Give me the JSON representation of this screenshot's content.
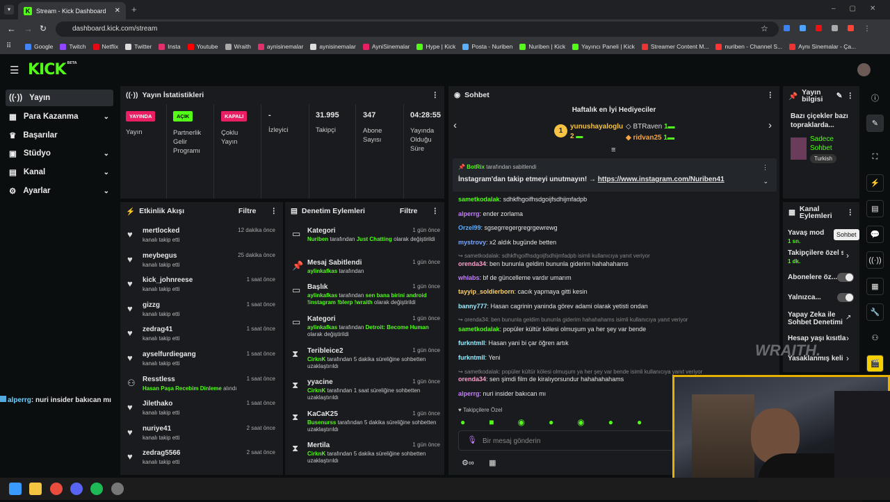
{
  "browser": {
    "tab_title": "Stream - Kick Dashboard",
    "url": "dashboard.kick.com/stream",
    "bookmarks": [
      "Google",
      "Twitch",
      "Netflix",
      "Twitter",
      "Insta",
      "Youtube",
      "Wraith",
      "aynisinemalar",
      "aynisinemalar",
      "AyniSinemalar",
      "Hype | Kick",
      "Posta - Nuriben",
      "Nuriben | Kick",
      "Yayıncı Paneli | Kick",
      "Streamer Content M...",
      "nuriben - Channel S...",
      "Aynı Sinemalar - Ça..."
    ]
  },
  "logo": "KICK",
  "logo_beta": "BETA",
  "sidebar": {
    "items": [
      {
        "label": "Yayın"
      },
      {
        "label": "Para Kazanma"
      },
      {
        "label": "Başarılar"
      },
      {
        "label": "Stüdyo"
      },
      {
        "label": "Kanal"
      },
      {
        "label": "Ayarlar"
      }
    ]
  },
  "stats": {
    "title": "Yayın İstatistikleri",
    "cols": [
      {
        "badge": "YAYINDA",
        "label": "Yayın"
      },
      {
        "badge": "AÇIK",
        "label": "Partnerlik Gelir Programı"
      },
      {
        "badge": "KAPALI",
        "label": "Çoklu Yayın"
      },
      {
        "value": "-",
        "label": "İzleyici"
      },
      {
        "value": "31.995",
        "label": "Takipçi"
      },
      {
        "value": "347",
        "label": "Abone Sayısı"
      },
      {
        "value": "04:28:55",
        "label": "Yayında Olduğu Süre"
      }
    ]
  },
  "activity": {
    "title": "Etkinlik Akışı",
    "filter": "Filtre",
    "items": [
      {
        "name": "mertlocked",
        "sub": "kanalı takip etti",
        "time": "12 dakika önce"
      },
      {
        "name": "meybegus",
        "sub": "kanalı takip etti",
        "time": "25 dakika önce"
      },
      {
        "name": "kick_johnreese",
        "sub": "kanalı takip etti",
        "time": "1 saat önce"
      },
      {
        "name": "gizzg",
        "sub": "kanalı takip etti",
        "time": "1 saat önce"
      },
      {
        "name": "zedrag41",
        "sub": "kanalı takip etti",
        "time": "1 saat önce"
      },
      {
        "name": "ayselfurdiegang",
        "sub": "kanalı takip etti",
        "time": "1 saat önce"
      },
      {
        "name": "Resstless",
        "sub_green": "Hasan Paşa Recebim Dinleme",
        "sub": "alındı",
        "time": "1 saat önce"
      },
      {
        "name": "Jilethako",
        "sub": "kanalı takip etti",
        "time": "1 saat önce"
      },
      {
        "name": "nuriye41",
        "sub": "kanalı takip etti",
        "time": "2 saat önce"
      },
      {
        "name": "zedrag5566",
        "sub": "kanalı takip etti",
        "time": "2 saat önce"
      }
    ]
  },
  "moderation": {
    "title": "Denetim Eylemleri",
    "filter": "Filtre",
    "items": [
      {
        "name": "Kategori",
        "u": "Nuriben",
        "m1": "tarafından",
        "v": "Just Chatting",
        "m2": "olarak değiştirildi",
        "time": "1 gün önce"
      },
      {
        "name": "Mesaj Sabitlendi",
        "u": "aylinkafkas",
        "m1": "tarafından",
        "v": "",
        "m2": "",
        "time": "1 gün önce"
      },
      {
        "name": "Başlık",
        "u": "aylinkafkas",
        "m1": "tarafından",
        "v": "sen bana birini android !instagram !blerp !wraith",
        "m2": "olarak değiştirildi",
        "time": "1 gün önce"
      },
      {
        "name": "Kategori",
        "u": "aylinkafkas",
        "m1": "tarafından",
        "v": "Detroit: Become Human",
        "m2": "olarak değiştirildi",
        "time": "1 gün önce"
      },
      {
        "name": "Teribleice2",
        "u": "CirknK",
        "m1": "tarafından 5 dakika süreliğine sohbetten uzaklaştırıldı",
        "v": "",
        "m2": "",
        "time": "1 gün önce"
      },
      {
        "name": "yyacine",
        "u": "CirknK",
        "m1": "tarafından 1 saat süreliğine sohbetten uzaklaştırıldı",
        "v": "",
        "m2": "",
        "time": "1 gün önce"
      },
      {
        "name": "KaCaK25",
        "u": "Busenurss",
        "m1": "tarafından 5 dakika süreliğine sohbetten uzaklaştırıldı",
        "v": "",
        "m2": "",
        "time": "1 gün önce"
      },
      {
        "name": "Mertila",
        "u": "CirknK",
        "m1": "tarafından 5 dakika süreliğine sohbetten uzaklaştırıldı",
        "v": "",
        "m2": "",
        "time": "1 gün önce"
      }
    ]
  },
  "chat": {
    "title": "Sohbet",
    "gifters_title": "Haftalık en İyi Hediyeciler",
    "gifters": [
      {
        "name": "yunushayaloglu",
        "count": "2",
        "rank": "1"
      },
      {
        "name": "BTRaven",
        "count": "1"
      },
      {
        "name": "ridvan25",
        "count": "1"
      }
    ],
    "pinned_by": "BotRix",
    "pinned_suffix": "tarafından sabitlendi",
    "pinned_text": "İnstagram'dan takip etmeyi unutmayın! →",
    "pinned_link": "https://www.instagram.com/Nuriben41",
    "messages": [
      {
        "user": "sametkodalak",
        "text": "sdhkfhgoifhsdgoijfsdhijmfadpb",
        "color": "#53fc18"
      },
      {
        "user": "alperrg",
        "text": "ender zorlama",
        "color": "#c77dff"
      },
      {
        "user": "Orzel99",
        "text": "sgsegrregergregrgewrewg",
        "color": "#5ab0ff"
      },
      {
        "user": "mystrovy",
        "text": "x2 aldık bugünde betten",
        "color": "#7aa7ff"
      },
      {
        "reply": "sametkodalak: sdhkfhgoifhsdgoijfsdhijmfadpb isimli kullanıcıya yanıt veriyor"
      },
      {
        "user": "orenda34",
        "text": "ben bununla geldim bununla giderim hahahahams",
        "color": "#ff9ecb"
      },
      {
        "user": "whiabs",
        "text": "bf de güncelleme vardır umarım",
        "color": "#c77dff"
      },
      {
        "user": "tayyip_soldierborn",
        "text": "cacık yapmaya gitti kesin",
        "color": "#ffd166"
      },
      {
        "user": "banny777",
        "text": "Hasan cagrinin yaninda görev adami olarak yetisti ondan",
        "color": "#9ef"
      },
      {
        "reply": "orenda34: ben bununla geldim bununla giderim hahahahams isimli kullanıcıya yanıt veriyor"
      },
      {
        "user": "sametkodalak",
        "text": "popüler kültür kölesi olmuşum ya her şey var bende",
        "color": "#53fc18"
      },
      {
        "user": "furkntmll",
        "text": "Hasan yani bi çar öğren artık",
        "color": "#9ef"
      },
      {
        "user": "furkntmll",
        "text": "Yeni",
        "color": "#9ef"
      },
      {
        "reply": "sametkodalak: popüler kültür kölesi olmuşum ya her şey var bende isimli kullanıcıya yanıt veriyor"
      },
      {
        "user": "orenda34",
        "text": "sen şimdi film de kiralıyorsundur hahahahahams",
        "color": "#ff9ecb"
      },
      {
        "user": "alperrg",
        "text": "nuri insider bakıcan mı",
        "color": "#c77dff"
      }
    ],
    "followers_only": "Takipçilere Özel",
    "input_placeholder": "Bir mesaj gönderin"
  },
  "stream_info": {
    "title": "Yayın bilgisi",
    "stream_title": "Bazı çiçekler bazı topraklarda...",
    "category": "Sadece Sohbet",
    "tag": "Turkish"
  },
  "channel_actions": {
    "title": "Kanal Eylemleri",
    "items": [
      {
        "label": "Yavaş mod",
        "sub": "1 sn."
      },
      {
        "label": "Takipçilere özel s",
        "sub": "1 dk."
      },
      {
        "label": "Abonelere öz..."
      },
      {
        "label": "Yalnızca..."
      },
      {
        "label": "Yapay Zeka ile Sohbet Denetimi"
      },
      {
        "label": "Hesap yaşı kısıtla"
      },
      {
        "label": "Yasaklanmış kelin"
      }
    ]
  },
  "tooltip": "Sohbet",
  "overlay_chat": {
    "user": "alperrg",
    "text": ": nuri insider bakıcan mı"
  },
  "watermark": "WRAITH."
}
